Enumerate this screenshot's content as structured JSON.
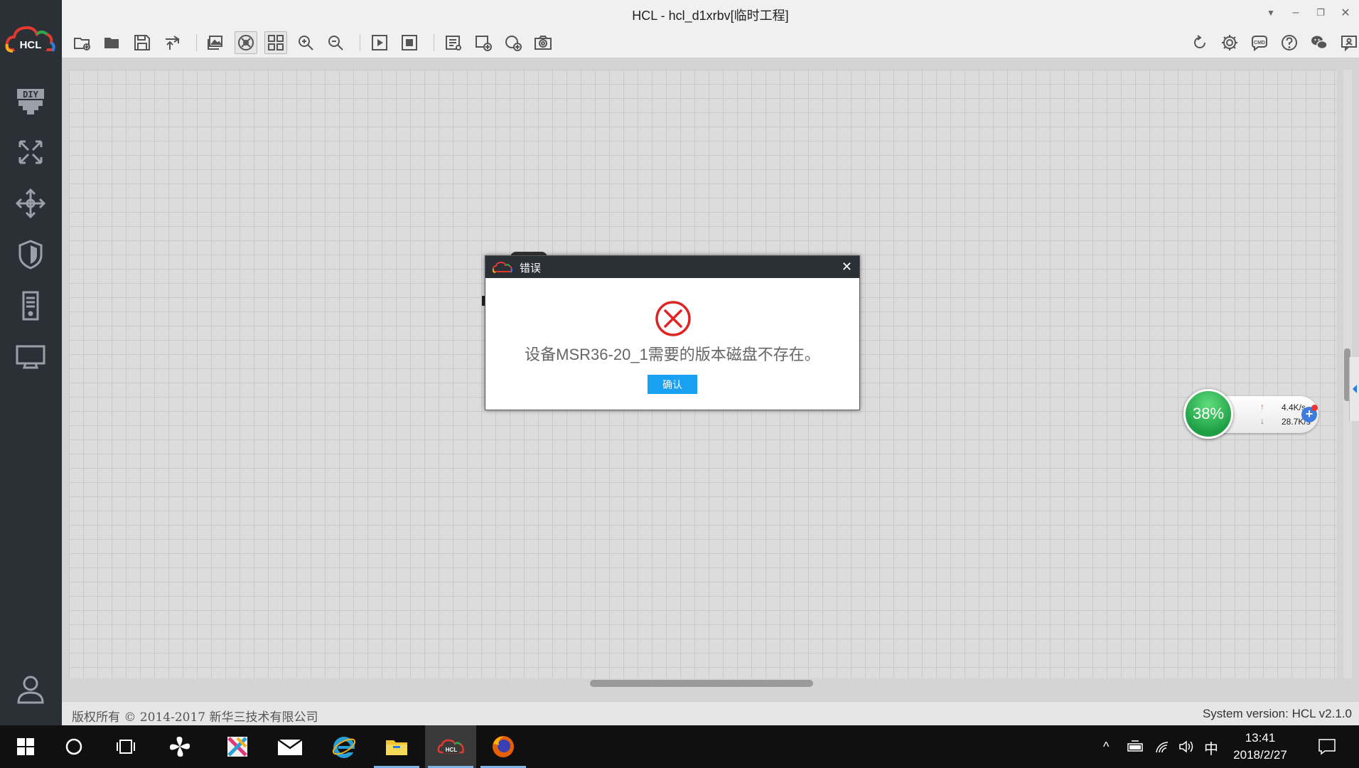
{
  "window": {
    "title": "HCL - hcl_d1xrbv[临时工程]",
    "controls": {
      "menu": "▼",
      "minimize": "–",
      "restore": "❐",
      "close": "✕"
    }
  },
  "logo": {
    "text": "HCL"
  },
  "sidebar": {
    "items": [
      {
        "name": "diy",
        "label": "DIY"
      },
      {
        "name": "router"
      },
      {
        "name": "switch"
      },
      {
        "name": "firewall"
      },
      {
        "name": "server"
      },
      {
        "name": "terminal"
      }
    ],
    "user": {
      "name": "user"
    }
  },
  "toolbar": {
    "left": [
      "new-project",
      "open-project",
      "save-project",
      "export",
      "screenshot-view",
      "topology-view",
      "grid-view",
      "zoom-in",
      "zoom-out",
      "start",
      "stop",
      "device-list",
      "add-device",
      "add-link",
      "capture"
    ],
    "right": [
      "refresh",
      "settings",
      "cmd",
      "help",
      "wechat",
      "feedback"
    ],
    "cmd_label": "CMD"
  },
  "dialog": {
    "title": "错误",
    "close": "✕",
    "message": "设备MSR36-20_1需要的版本磁盘不存在。",
    "confirm_label": "确认"
  },
  "net_widget": {
    "percent": "38%",
    "upload": "4.4K/s",
    "download": "28.7K/s",
    "up_arrow": "↑",
    "down_arrow": "↓",
    "plus": "+"
  },
  "statusbar": {
    "copyright": "版权所有 © 2014-2017 新华三技术有限公司",
    "system_version": "System version: HCL v2.1.0"
  },
  "taskbar": {
    "tray": {
      "ime": "中",
      "up_chevron": "^"
    },
    "time": "13:41",
    "date": "2018/2/27",
    "hcl_label": "HCL"
  },
  "colors": {
    "sidebar_bg": "#2b2f36",
    "accent_blue": "#1aa0f0",
    "error_red": "#e02424",
    "net_green": "#1f9f45"
  }
}
